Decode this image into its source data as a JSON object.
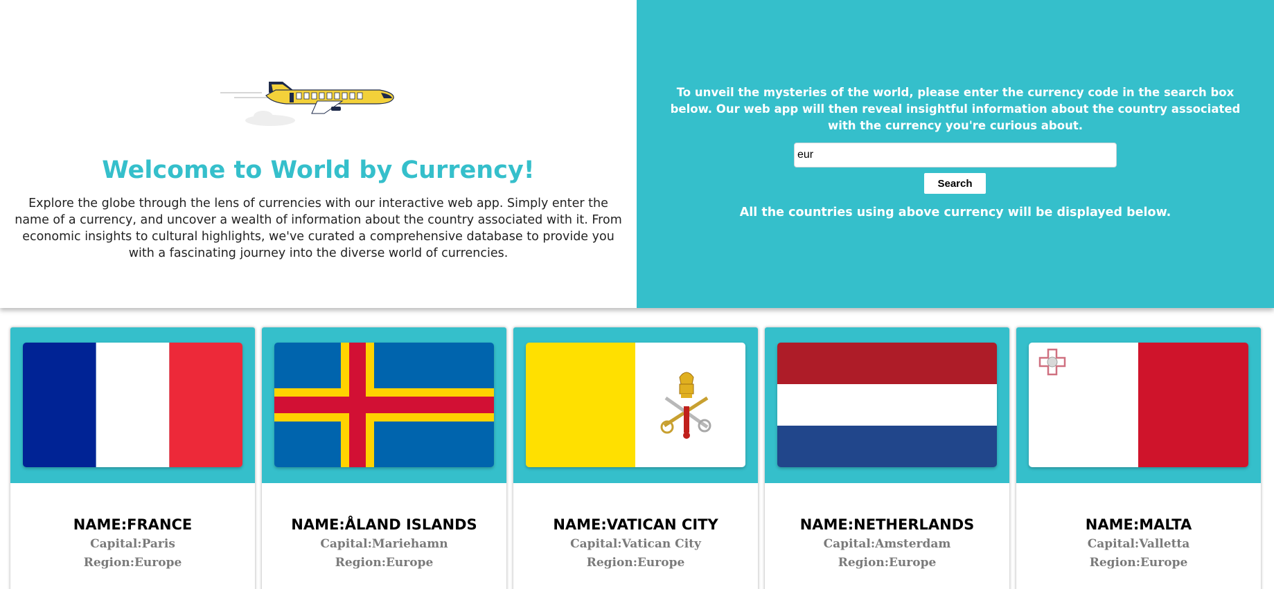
{
  "welcome": {
    "title": "Welcome to World by Currency!",
    "description": "Explore the globe through the lens of currencies with our interactive web app. Simply enter the name of a currency, and uncover a wealth of information about the country associated with it. From economic insights to cultural highlights, we've curated a comprehensive database to provide you with a fascinating journey into the diverse world of currencies.",
    "illustration": "airplane-illustration"
  },
  "search": {
    "instructions": "To unveil the mysteries of the world, please enter the currency code in the search box below. Our web app will then reveal insightful information about the country associated with the currency you're curious about.",
    "value": "eur",
    "placeholder": "",
    "button_label": "Search",
    "results_note": "All the countries using above currency will be displayed below."
  },
  "colors": {
    "accent": "#35bfcb",
    "card_text_muted": "#7a7a7a"
  },
  "countries": [
    {
      "name": "NAME:FRANCE",
      "capital": "Capital:Paris",
      "region": "Region:Europe",
      "flag": "france-flag"
    },
    {
      "name": "NAME:ÅLAND ISLANDS",
      "capital": "Capital:Mariehamn",
      "region": "Region:Europe",
      "flag": "aland-islands-flag"
    },
    {
      "name": "NAME:VATICAN CITY",
      "capital": "Capital:Vatican City",
      "region": "Region:Europe",
      "flag": "vatican-city-flag"
    },
    {
      "name": "NAME:NETHERLANDS",
      "capital": "Capital:Amsterdam",
      "region": "Region:Europe",
      "flag": "netherlands-flag"
    },
    {
      "name": "NAME:MALTA",
      "capital": "Capital:Valletta",
      "region": "Region:Europe",
      "flag": "malta-flag"
    }
  ]
}
